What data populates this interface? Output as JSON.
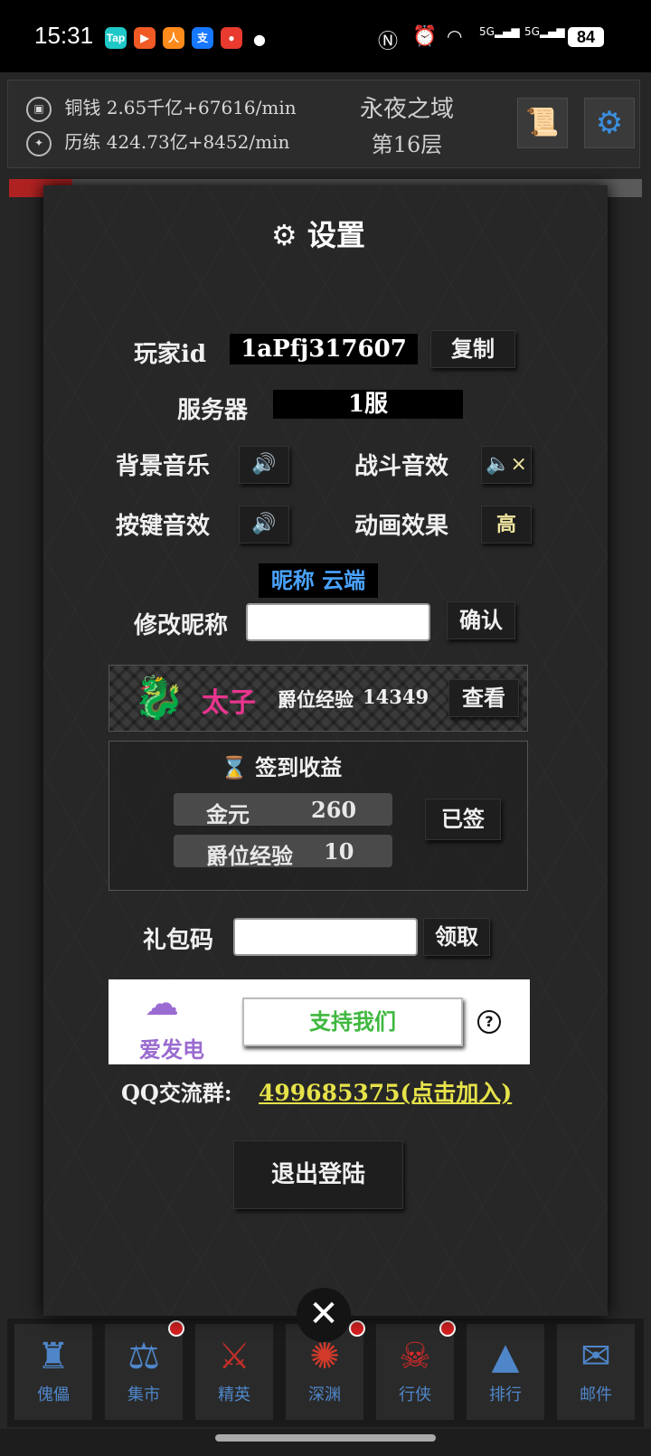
{
  "status_bar": {
    "time": "15:31",
    "apps": [
      {
        "name": "tap-icon",
        "text": "Tap",
        "color": "#1fc8c8"
      },
      {
        "name": "video-icon",
        "text": "▶",
        "color": "#f05a24"
      },
      {
        "name": "app-icon",
        "text": "人",
        "color": "#ff8a1c"
      },
      {
        "name": "alipay-icon",
        "text": "支",
        "color": "#1677ff"
      },
      {
        "name": "redpacket-icon",
        "text": "●",
        "color": "#e83a2e"
      }
    ],
    "battery": "84",
    "signal_1": "5G",
    "signal_2": "5G"
  },
  "topbar": {
    "copper_label": "铜钱",
    "copper_value": "2.65千亿+67616/min",
    "exp_label": "历练",
    "exp_value": "424.73亿+8452/min",
    "zone_title": "永夜之域",
    "floor": "第16层"
  },
  "modal": {
    "title": "设置",
    "player_id_label": "玩家id",
    "player_id": "1aPfj317607",
    "copy_button": "复制",
    "server_label": "服务器",
    "server_value": "1服",
    "bgm_label": "背景音乐",
    "battle_sfx_label": "战斗音效",
    "key_sfx_label": "按键音效",
    "anim_label": "动画效果",
    "anim_value": "高",
    "nickname_display": "昵称 云端",
    "change_nickname_label": "修改昵称",
    "confirm_button": "确认",
    "nobility_title": "太子",
    "nobility_exp_label": "爵位经验",
    "nobility_exp_value": "14349",
    "view_button": "查看",
    "checkin_title": "签到收益",
    "reward_gold_label": "金元",
    "reward_gold_value": "260",
    "reward_exp_label": "爵位经验",
    "reward_exp_value": "10",
    "checked_button": "已签",
    "gift_code_label": "礼包码",
    "claim_button": "领取",
    "afdian_label": "爱发电",
    "support_button": "支持我们",
    "help_icon": "?",
    "qq_label": "QQ交流群:",
    "qq_link": "499685375(点击加入)",
    "logout_button": "退出登陆"
  },
  "nav": [
    {
      "label": "傀儡",
      "icon": "robot-icon",
      "glyph": "♜",
      "color": "#4f86c9",
      "dot": false
    },
    {
      "label": "集市",
      "icon": "scale-icon",
      "glyph": "⚖",
      "color": "#4f86c9",
      "dot": true
    },
    {
      "label": "精英",
      "icon": "sword-wing-icon",
      "glyph": "⚔",
      "color": "#c0302a",
      "dot": false
    },
    {
      "label": "深渊",
      "icon": "vortex-icon",
      "glyph": "✺",
      "color": "#d23a2a",
      "dot": true
    },
    {
      "label": "行侠",
      "icon": "skull-icon",
      "glyph": "☠",
      "color": "#d42a2a",
      "dot": true
    },
    {
      "label": "排行",
      "icon": "pyramid-icon",
      "glyph": "▲",
      "color": "#4f86c9",
      "dot": false
    },
    {
      "label": "邮件",
      "icon": "mail-icon",
      "glyph": "✉",
      "color": "#4f86c9",
      "dot": false
    }
  ],
  "colors": {
    "accent_green": "#3fb83f",
    "link_yellow": "#e6e24a",
    "nickname_blue": "#4aa3ff",
    "nobility_pink": "#e8358e",
    "afdian_purple": "#9a6bd0"
  }
}
